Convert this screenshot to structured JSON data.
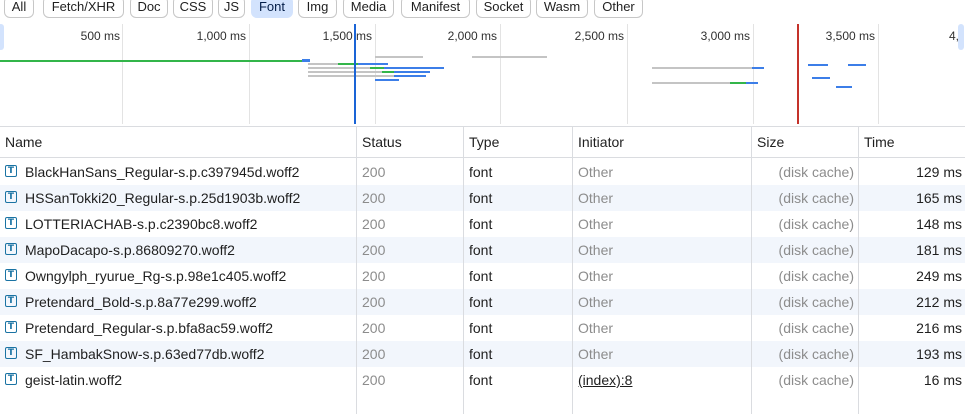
{
  "filters": [
    "All",
    "Fetch/XHR",
    "Doc",
    "CSS",
    "JS",
    "Font",
    "Img",
    "Media",
    "Manifest",
    "Socket",
    "Wasm",
    "Other"
  ],
  "active_filter": "Font",
  "timeline": {
    "ticks": [
      "500 ms",
      "1,000 ms",
      "1,500 ms",
      "2,000 ms",
      "2,500 ms",
      "3,000 ms",
      "3,500 ms",
      "4,"
    ],
    "colors": {
      "waiting": "#c4c4c4",
      "download": "#3c7ee8",
      "green": "#33b54a",
      "dom_marker": "#1a64d6",
      "load_marker": "#c4322a"
    }
  },
  "columns": {
    "name": "Name",
    "status": "Status",
    "type": "Type",
    "initiator": "Initiator",
    "size": "Size",
    "time": "Time"
  },
  "rows": [
    {
      "name": "BlackHanSans_Regular-s.p.c397945d.woff2",
      "status": "200",
      "type": "font",
      "initiator": "Other",
      "size": "(disk cache)",
      "time": "129 ms",
      "icon": "font-file-icon"
    },
    {
      "name": "HSSanTokki20_Regular-s.p.25d1903b.woff2",
      "status": "200",
      "type": "font",
      "initiator": "Other",
      "size": "(disk cache)",
      "time": "165 ms",
      "icon": "font-file-icon"
    },
    {
      "name": "LOTTERIACHAB-s.p.c2390bc8.woff2",
      "status": "200",
      "type": "font",
      "initiator": "Other",
      "size": "(disk cache)",
      "time": "148 ms",
      "icon": "font-file-icon"
    },
    {
      "name": "MapoDacapo-s.p.86809270.woff2",
      "status": "200",
      "type": "font",
      "initiator": "Other",
      "size": "(disk cache)",
      "time": "181 ms",
      "icon": "font-file-icon"
    },
    {
      "name": "Owngylph_ryurue_Rg-s.p.98e1c405.woff2",
      "status": "200",
      "type": "font",
      "initiator": "Other",
      "size": "(disk cache)",
      "time": "249 ms",
      "icon": "font-file-icon"
    },
    {
      "name": "Pretendard_Bold-s.p.8a77e299.woff2",
      "status": "200",
      "type": "font",
      "initiator": "Other",
      "size": "(disk cache)",
      "time": "212 ms",
      "icon": "font-file-icon"
    },
    {
      "name": "Pretendard_Regular-s.p.bfa8ac59.woff2",
      "status": "200",
      "type": "font",
      "initiator": "Other",
      "size": "(disk cache)",
      "time": "216 ms",
      "icon": "font-file-icon"
    },
    {
      "name": "SF_HambakSnow-s.p.63ed77db.woff2",
      "status": "200",
      "type": "font",
      "initiator": "Other",
      "size": "(disk cache)",
      "time": "193 ms",
      "icon": "font-file-icon"
    },
    {
      "name": "geist-latin.woff2",
      "status": "200",
      "type": "font",
      "initiator": "(index):8",
      "size": "(disk cache)",
      "time": "16 ms",
      "icon": "font-file-icon"
    }
  ]
}
